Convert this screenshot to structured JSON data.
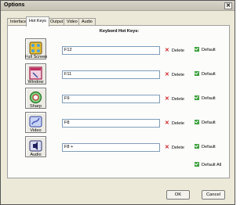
{
  "window": {
    "title": "Options",
    "close_glyph": "✕"
  },
  "tabs": [
    {
      "label": "Interface"
    },
    {
      "label": "Hot Keys"
    },
    {
      "label": "Output"
    },
    {
      "label": "Video"
    },
    {
      "label": "Audio"
    }
  ],
  "panel": {
    "heading": "Keybord Hot Keys:"
  },
  "hotkeys": [
    {
      "label": "Full Screen",
      "value": "F12",
      "icon": "fullscreen-icon"
    },
    {
      "label": "Window",
      "value": "F11",
      "icon": "window-icon"
    },
    {
      "label": "Sharp",
      "value": "F9",
      "icon": "sharp-icon"
    },
    {
      "label": "Video",
      "value": "F8",
      "icon": "video-icon"
    },
    {
      "label": "Audio",
      "value": "F8 +",
      "icon": "audio-icon"
    }
  ],
  "actions": {
    "delete": "Delete",
    "default": "Default",
    "default_all": "Default All"
  },
  "buttons": {
    "ok": "OK",
    "cancel": "Cancel"
  },
  "colors": {
    "delete_x": "#d12020",
    "default_check": "#3ca03c"
  }
}
